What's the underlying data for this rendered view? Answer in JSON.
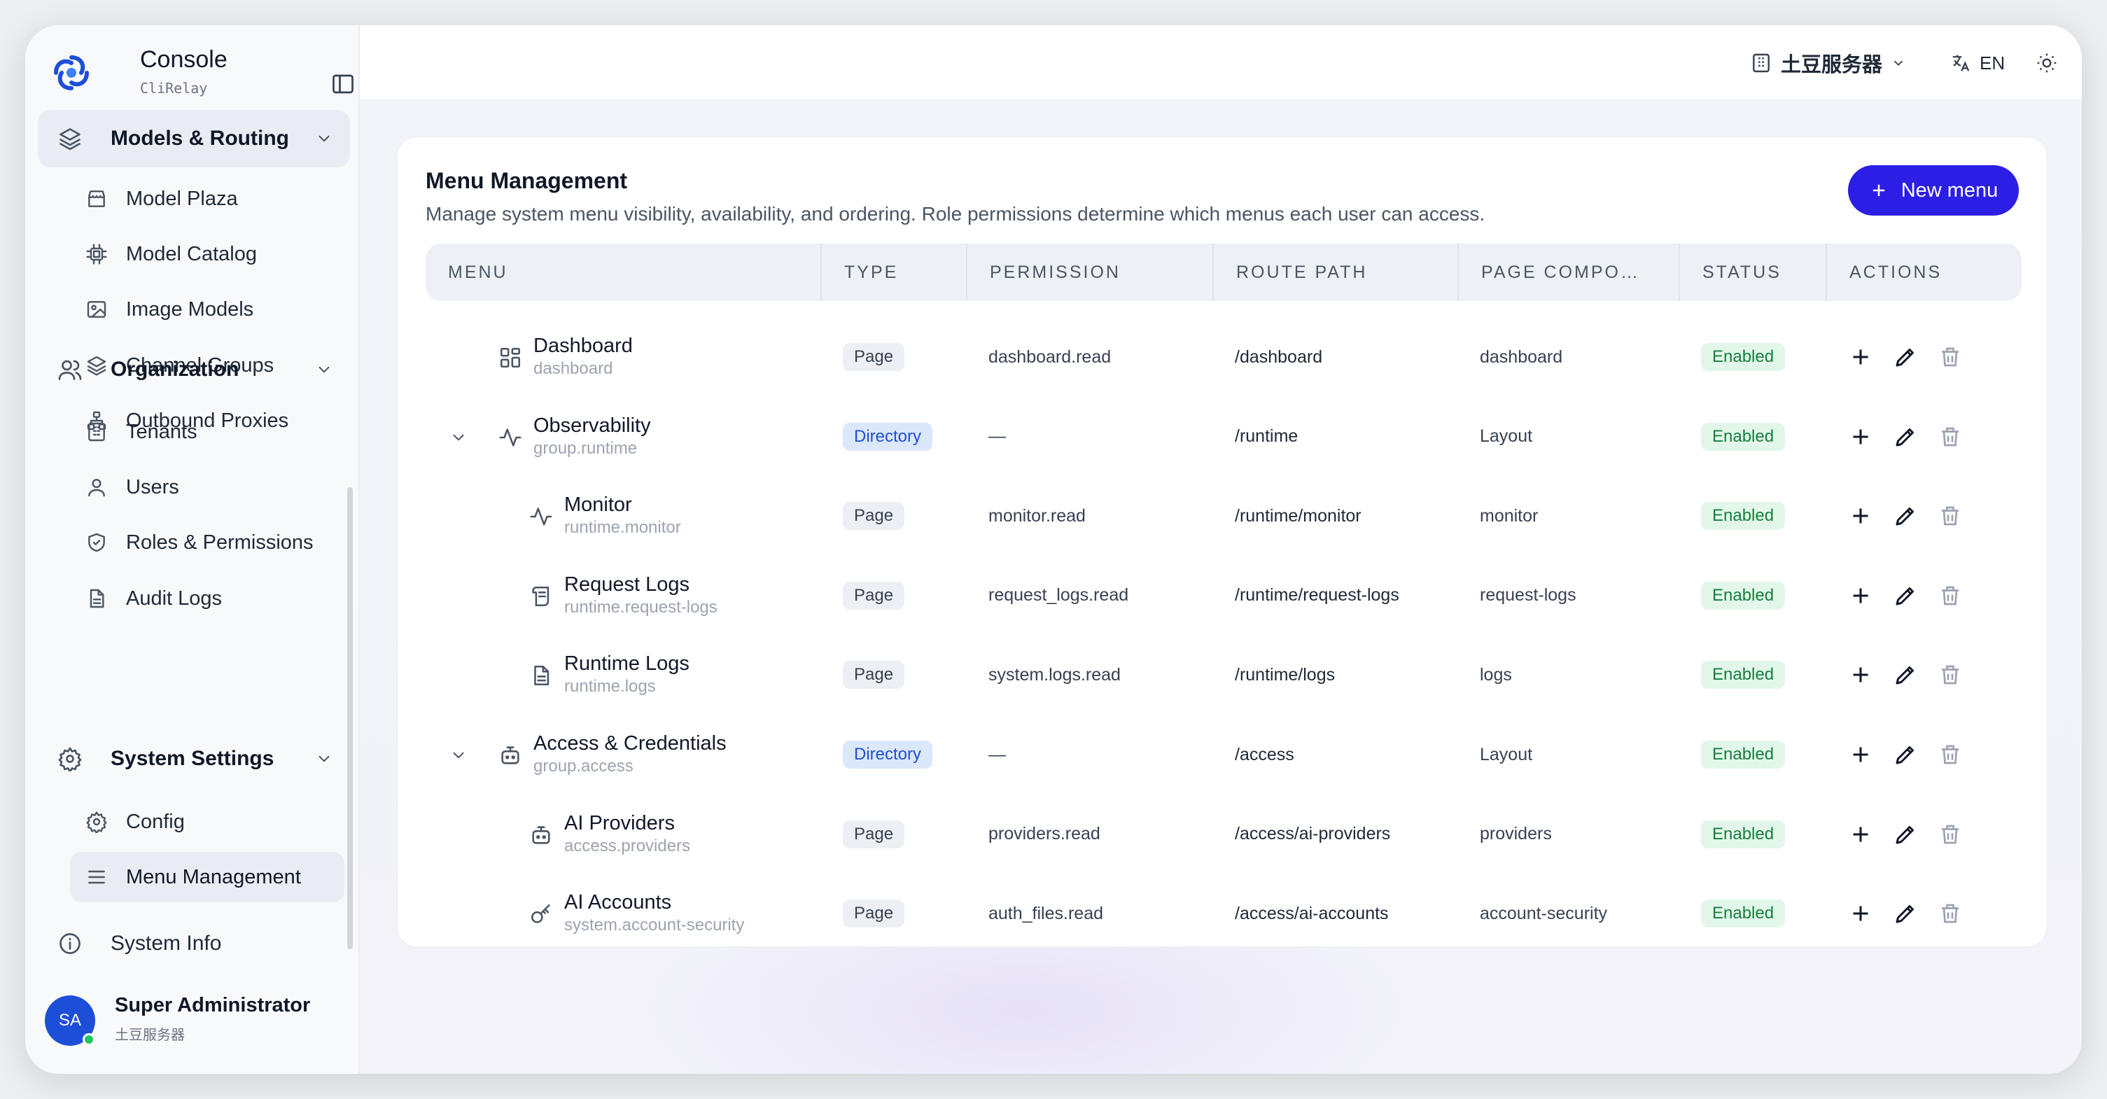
{
  "app": {
    "title": "Console",
    "subtitle": "CliRelay"
  },
  "sidebar": {
    "groups": [
      {
        "label": "Models & Routing",
        "items": [
          "Model Plaza",
          "Model Catalog",
          "Image Models",
          "Channel Groups",
          "Outbound Proxies"
        ]
      },
      {
        "label": "Organization",
        "items": [
          "Tenants",
          "Users",
          "Roles & Permissions",
          "Audit Logs"
        ]
      },
      {
        "label": "System Settings",
        "items": [
          "Config",
          "Menu Management"
        ]
      },
      {
        "label": "System Info",
        "items": []
      }
    ],
    "active_item": "Menu Management"
  },
  "user": {
    "initials": "SA",
    "name": "Super Administrator",
    "server": "土豆服务器"
  },
  "topbar": {
    "server": "土豆服务器",
    "language": "EN"
  },
  "page": {
    "title": "Menu Management",
    "description": "Manage system menu visibility, availability, and ordering. Role permissions determine which menus each user can access.",
    "new_button": "New menu"
  },
  "table": {
    "columns": [
      "MENU",
      "TYPE",
      "PERMISSION",
      "ROUTE PATH",
      "PAGE COMPO…",
      "STATUS",
      "ACTIONS"
    ],
    "rows": [
      {
        "name": "Dashboard",
        "key": "dashboard",
        "type": "Page",
        "permission": "dashboard.read",
        "route": "/dashboard",
        "component": "dashboard",
        "status": "Enabled",
        "level": 0,
        "expandable": false,
        "icon": "dashboard-icon"
      },
      {
        "name": "Observability",
        "key": "group.runtime",
        "type": "Directory",
        "permission": "—",
        "route": "/runtime",
        "component": "Layout",
        "status": "Enabled",
        "level": 0,
        "expandable": true,
        "icon": "activity-icon"
      },
      {
        "name": "Monitor",
        "key": "runtime.monitor",
        "type": "Page",
        "permission": "monitor.read",
        "route": "/runtime/monitor",
        "component": "monitor",
        "status": "Enabled",
        "level": 1,
        "expandable": false,
        "icon": "activity-icon"
      },
      {
        "name": "Request Logs",
        "key": "runtime.request-logs",
        "type": "Page",
        "permission": "request_logs.read",
        "route": "/runtime/request-logs",
        "component": "request-logs",
        "status": "Enabled",
        "level": 1,
        "expandable": false,
        "icon": "scroll-icon"
      },
      {
        "name": "Runtime Logs",
        "key": "runtime.logs",
        "type": "Page",
        "permission": "system.logs.read",
        "route": "/runtime/logs",
        "component": "logs",
        "status": "Enabled",
        "level": 1,
        "expandable": false,
        "icon": "file-text-icon"
      },
      {
        "name": "Access & Credentials",
        "key": "group.access",
        "type": "Directory",
        "permission": "—",
        "route": "/access",
        "component": "Layout",
        "status": "Enabled",
        "level": 0,
        "expandable": true,
        "icon": "bot-icon"
      },
      {
        "name": "AI Providers",
        "key": "access.providers",
        "type": "Page",
        "permission": "providers.read",
        "route": "/access/ai-providers",
        "component": "providers",
        "status": "Enabled",
        "level": 1,
        "expandable": false,
        "icon": "bot-icon"
      },
      {
        "name": "AI Accounts",
        "key": "system.account-security",
        "type": "Page",
        "permission": "auth_files.read",
        "route": "/access/ai-accounts",
        "component": "account-security",
        "status": "Enabled",
        "level": 1,
        "expandable": false,
        "icon": "key-icon"
      }
    ]
  },
  "colors": {
    "accent": "#2d1ee6",
    "enabled": "#15803d",
    "directory": "#1d4ed8"
  }
}
